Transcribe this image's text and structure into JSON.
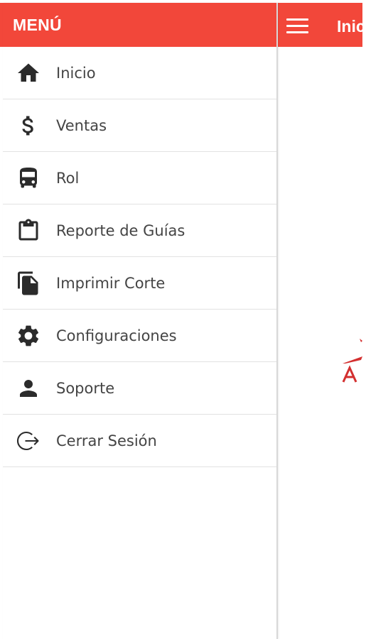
{
  "drawer": {
    "title": "MENÚ",
    "items": [
      {
        "label": "Inicio",
        "icon": "home-icon"
      },
      {
        "label": "Ventas",
        "icon": "dollar-icon"
      },
      {
        "label": "Rol",
        "icon": "bus-icon"
      },
      {
        "label": "Reporte de Guías",
        "icon": "clipboard-icon"
      },
      {
        "label": "Imprimir Corte",
        "icon": "document-icon"
      },
      {
        "label": "Configuraciones",
        "icon": "gear-icon"
      },
      {
        "label": "Soporte",
        "icon": "person-icon"
      },
      {
        "label": "Cerrar Sesión",
        "icon": "logout-icon"
      }
    ]
  },
  "header": {
    "title": "Inicio",
    "menu_icon": "hamburger-icon"
  },
  "colors": {
    "accent": "#f2473a",
    "icon": "#222222",
    "text": "#444444",
    "divider": "#e2e2e2"
  }
}
